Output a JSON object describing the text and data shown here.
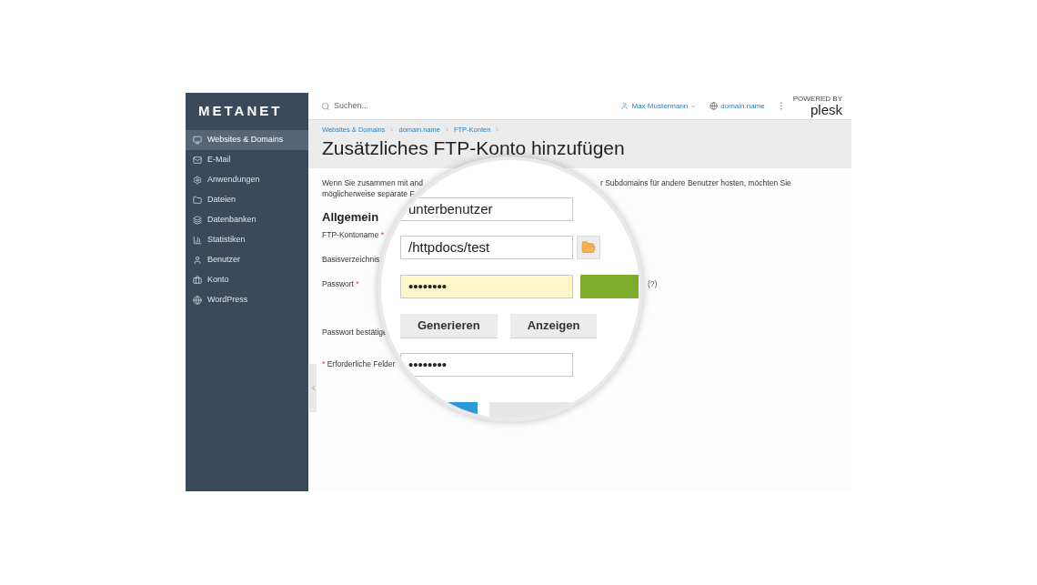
{
  "brand": "METANET",
  "sidebar": {
    "items": [
      {
        "label": "Websites & Domains",
        "selected": true
      },
      {
        "label": "E-Mail",
        "selected": false
      },
      {
        "label": "Anwendungen",
        "selected": false
      },
      {
        "label": "Dateien",
        "selected": false
      },
      {
        "label": "Datenbanken",
        "selected": false
      },
      {
        "label": "Statistiken",
        "selected": false
      },
      {
        "label": "Benutzer",
        "selected": false
      },
      {
        "label": "Konto",
        "selected": false
      },
      {
        "label": "WordPress",
        "selected": false
      }
    ]
  },
  "topbar": {
    "search": {
      "placeholder": "Suchen..."
    },
    "user": "Max Mustermann",
    "domain": "domain.name",
    "logo": {
      "tagline": "POWERED BY",
      "name": "plesk"
    }
  },
  "breadcrumbs": [
    "Websites & Domains",
    "domain.name",
    "FTP-Konten"
  ],
  "title": "Zusätzliches FTP-Konto hinzufügen",
  "intro": {
    "line1_start": "Wenn Sie zusammen mit and",
    "line1_end": "r Subdomains für andere Benutzer hosten, möchten Sie",
    "line2": "möglicherweise separate F"
  },
  "section": "Allgemein",
  "labels": [
    {
      "text": "FTP-Kontoname",
      "mark": "*"
    },
    {
      "text": "Basisverzeichnis"
    },
    {
      "text": "Passwort",
      "mark": "*",
      "help": "(?)"
    }
  ],
  "confirm_label": "Passwort bestätige",
  "required_note": {
    "mark": "*",
    "text": "Erforderliche Felder"
  },
  "magnifier": {
    "fields": [
      {
        "value": "unterbenutzer",
        "highlighted": false,
        "browse": false,
        "strength": false
      },
      {
        "value": "/httpdocs/test",
        "highlighted": false,
        "browse": true,
        "strength": false
      },
      {
        "value": "••••••••",
        "highlighted": true,
        "browse": false,
        "strength": true
      }
    ],
    "buttons": [
      "Generieren",
      "Anzeigen"
    ],
    "confirm": {
      "value": "••••••••",
      "highlighted": false
    }
  }
}
